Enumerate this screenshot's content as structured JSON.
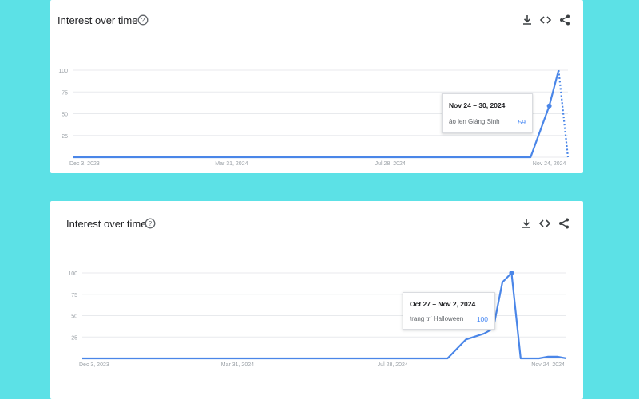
{
  "colors": {
    "background": "#5ce1e6",
    "card": "#ffffff",
    "line": "#4a86e8",
    "grid": "#e8eaed",
    "axis_text": "#9aa0a6",
    "title_text": "#202124"
  },
  "icons": [
    "help-circle-icon",
    "download-icon",
    "embed-code-icon",
    "share-icon"
  ],
  "chart_data": [
    {
      "type": "line",
      "title": "Interest over time",
      "x_ticks": [
        "Dec 3, 2023",
        "Mar 31, 2024",
        "Jul 28, 2024",
        "Nov 24, 2024"
      ],
      "y_ticks": [
        "100",
        "75",
        "50",
        "25"
      ],
      "ylim": [
        0,
        100
      ],
      "grid": true,
      "series": [
        {
          "name": "áo len Giáng Sinh",
          "x": [
            "2023-12-03",
            "2024-11-10",
            "2024-11-24",
            "2024-12-01"
          ],
          "y": [
            0,
            0,
            59,
            100
          ],
          "partial_last": {
            "x": "2024-12-08",
            "y": 0
          }
        }
      ],
      "tooltip": {
        "date": "Nov 24 – 30, 2024",
        "term": "áo len Giáng Sinh",
        "value": "59"
      }
    },
    {
      "type": "line",
      "title": "Interest over time",
      "x_ticks": [
        "Dec 3, 2023",
        "Mar 31, 2024",
        "Jul 28, 2024",
        "Nov 24, 2024"
      ],
      "y_ticks": [
        "100",
        "75",
        "50",
        "25"
      ],
      "ylim": [
        0,
        100
      ],
      "grid": true,
      "series": [
        {
          "name": "trang trí Halloween",
          "x": [
            "2023-12-03",
            "2024-09-08",
            "2024-09-22",
            "2024-10-06",
            "2024-10-13",
            "2024-10-20",
            "2024-10-27",
            "2024-11-03",
            "2024-11-17",
            "2024-11-24",
            "2024-12-01",
            "2024-12-08"
          ],
          "y": [
            0,
            0,
            22,
            29,
            35,
            89,
            100,
            0,
            0,
            2,
            2,
            0
          ]
        }
      ],
      "tooltip": {
        "date": "Oct 27 – Nov 2, 2024",
        "term": "trang trí Halloween",
        "value": "100"
      }
    }
  ]
}
